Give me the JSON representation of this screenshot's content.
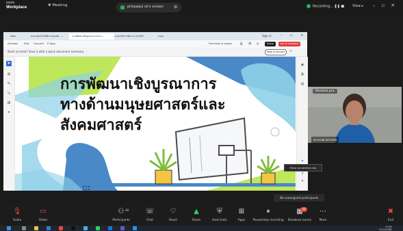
{
  "app": {
    "name_line1": "zoom",
    "name_line2": "Workplace",
    "meeting_label": "Meeting"
  },
  "share_pill": {
    "label": "pimpaqui sk's screen"
  },
  "status": {
    "recording": "Recording...",
    "view": "View"
  },
  "browser": {
    "tabs": [
      "New",
      "คณะเทคโนโลยีสารสนเทศ - ...",
      "การพัฒนาเชิงบูรณาการทาง...",
      "ระบบบริหารจัดการ 2/2567",
      "Lxxx"
    ],
    "signin": "Sign in"
  },
  "pdf": {
    "menu": [
      "All tools",
      "Edit",
      "Convert",
      "E-Sign"
    ],
    "find": "Find text or tools",
    "share": "Share",
    "ai": "Ask AI Assistant",
    "notice": "Short on time? Save it with a quick document summary",
    "view_summary": "View Summary",
    "page_current": "5",
    "page_total": "7",
    "slide_title_lines": [
      "การพัฒนาเชิงบูรณาการ",
      "ทางด้านมนุษยศาสตร์และ",
      "สังคมศาสตร์"
    ]
  },
  "video": {
    "rename_label": "Rename pcs",
    "participant_name": "ดร.กรรณ์ เทรวรรณ"
  },
  "tooltip": {
    "text": "Show annotation bar"
  },
  "unassigned": {
    "text": "48 unassigned participants"
  },
  "toolbar": {
    "audio": "Audio",
    "video": "Video",
    "participants": "Participants",
    "participant_count": "48",
    "chat": "Chat",
    "react": "React",
    "share": "Share",
    "host_tools": "Host tools",
    "apps": "Apps",
    "pause_recording": "Pause/stop recording",
    "breakout": "Breakout rooms",
    "breakout_badge": "48",
    "more": "More",
    "end": "End"
  },
  "clock": {
    "time": "11:56",
    "date": "21/11/2568"
  },
  "colors": {
    "end_red": "#e74c3c",
    "share_green": "#2ecc71",
    "slide_blue": "#4a89c8",
    "slide_green": "#b7e44a"
  }
}
